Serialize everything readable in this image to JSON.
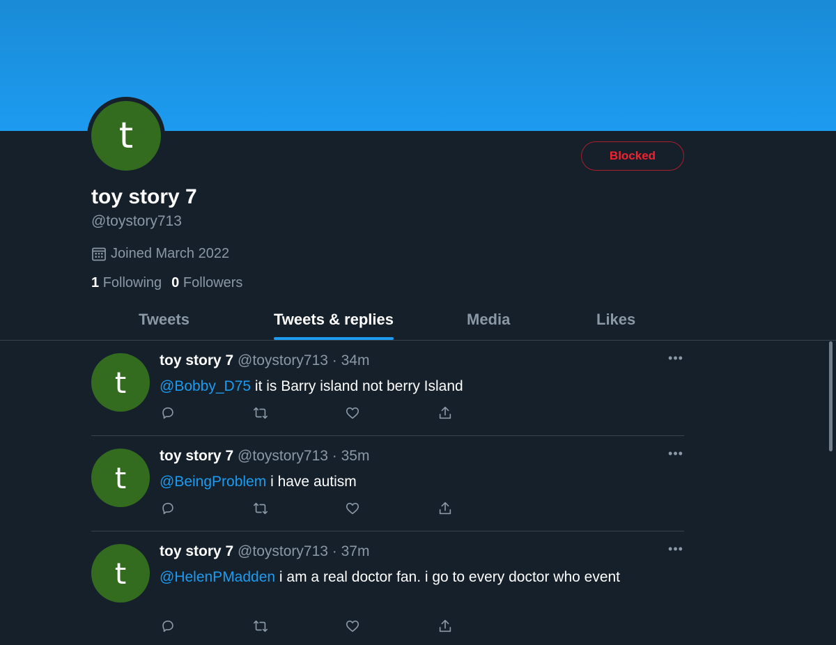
{
  "profile": {
    "avatar_letter": "t",
    "display_name": "toy story 7",
    "handle": "@toystory713",
    "joined": "Joined March 2022",
    "following_count": "1",
    "following_label": "Following",
    "followers_count": "0",
    "followers_label": "Followers",
    "blocked_label": "Blocked"
  },
  "tabs": [
    {
      "label": "Tweets",
      "active": false
    },
    {
      "label": "Tweets & replies",
      "active": true
    },
    {
      "label": "Media",
      "active": false
    },
    {
      "label": "Likes",
      "active": false
    }
  ],
  "tweets": [
    {
      "avatar_letter": "t",
      "name": "toy story 7",
      "meta": "@toystory713 · 34m",
      "mention": "@Bobby_D75",
      "text": " it is Barry island not berry Island"
    },
    {
      "avatar_letter": "t",
      "name": "toy story 7",
      "meta": "@toystory713 · 35m",
      "mention": "@BeingProblem",
      "text": " i have autism"
    },
    {
      "avatar_letter": "t",
      "name": "toy story 7",
      "meta": "@toystory713 · 37m",
      "mention": "@HelenPMadden",
      "text": " i am a real doctor fan. i go to every doctor who event"
    }
  ],
  "icons": {
    "more": "more-horizontal-icon",
    "reply": "reply-icon",
    "retweet": "retweet-icon",
    "like": "heart-icon",
    "share": "share-icon",
    "calendar": "calendar-icon"
  },
  "colors": {
    "background": "#15202b",
    "banner": "#1d9bf0",
    "accent": "#1d9bf0",
    "blocked": "#f4212e",
    "avatar": "#336b1f",
    "muted": "#8b98a5"
  }
}
